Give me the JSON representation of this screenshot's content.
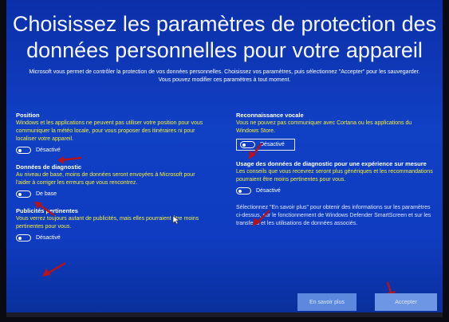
{
  "title": "Choisissez les paramètres de protection des données personnelles pour votre appareil",
  "intro": "Microsoft vous permet de contrôler la protection de vos données personnelles. Choisissez vos paramètres, puis sélectionnez \"Accepter\" pour les sauvegarder. Vous pouvez modifier ces paramètres à tout moment.",
  "settings_left": [
    {
      "heading": "Position",
      "description": "Windows et les applications ne peuvent pas utiliser votre position pour vous communiquer la météo locale, pour vous proposer des itinéraires ni pour localiser votre appareil.",
      "toggle": "Désactivé"
    },
    {
      "heading": "Données de diagnostic",
      "description": "Au niveau de base, moins de données seront envoyées à Microsoft pour l'aider à corriger les erreurs que vous rencontrez.",
      "toggle": "De base"
    },
    {
      "heading": "Publicités pertinentes",
      "description": "Vous verrez toujours autant de publicités, mais elles pourraient être moins pertinentes pour vous.",
      "toggle": "Désactivé"
    }
  ],
  "settings_right": [
    {
      "heading": "Reconnaissance vocale",
      "description": "Vous ne pouvez pas communiquer avec Cortana ou les applications du Windows Store.",
      "toggle": "Désactivé"
    },
    {
      "heading": "Usage des données de diagnostic pour une expérience sur mesure",
      "description": "Les conseils que vous recevrez seront plus génériques et les recommandations pourraient être moins pertinentes pour vous.",
      "toggle": "Désactivé"
    }
  ],
  "footer_note": "Sélectionnez \"En savoir plus\" pour obtenir des informations sur les paramètres ci-dessus, sur le fonctionnement de Windows Defender SmartScreen et sur les transferts et les utilisations de données associés.",
  "buttons": {
    "learn_more": "En savoir plus",
    "accept": "Accepter"
  },
  "colors": {
    "background": "#0f3cc0",
    "description_text": "#f3ee3a",
    "arrow": "#b3121e"
  }
}
